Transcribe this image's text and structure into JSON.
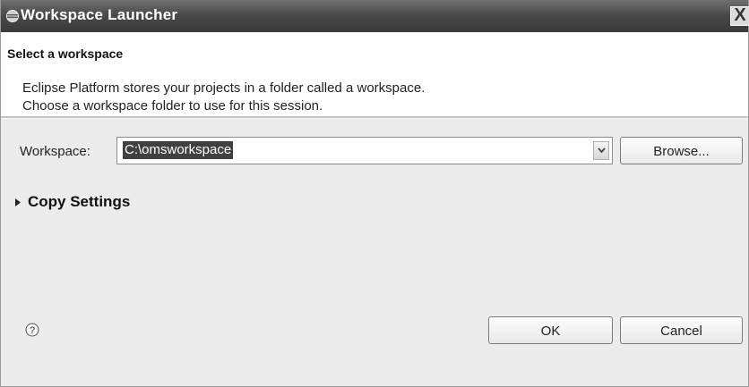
{
  "window": {
    "title": "Workspace Launcher",
    "close_label": "X"
  },
  "banner": {
    "title": "Select a workspace",
    "message_line1": "Eclipse Platform stores your projects in a folder called a workspace.",
    "message_line2": "Choose a workspace folder to use for this session."
  },
  "workspace": {
    "label": "Workspace:",
    "value": "C:\\omsworkspace",
    "browse_label": "Browse..."
  },
  "copy_settings": {
    "label": "Copy Settings",
    "expanded": false
  },
  "footer": {
    "ok_label": "OK",
    "cancel_label": "Cancel"
  },
  "icons": {
    "title": "eclipse-logo-icon",
    "help": "help-icon",
    "dropdown": "chevron-down-icon",
    "expand": "triangle-right-icon"
  }
}
